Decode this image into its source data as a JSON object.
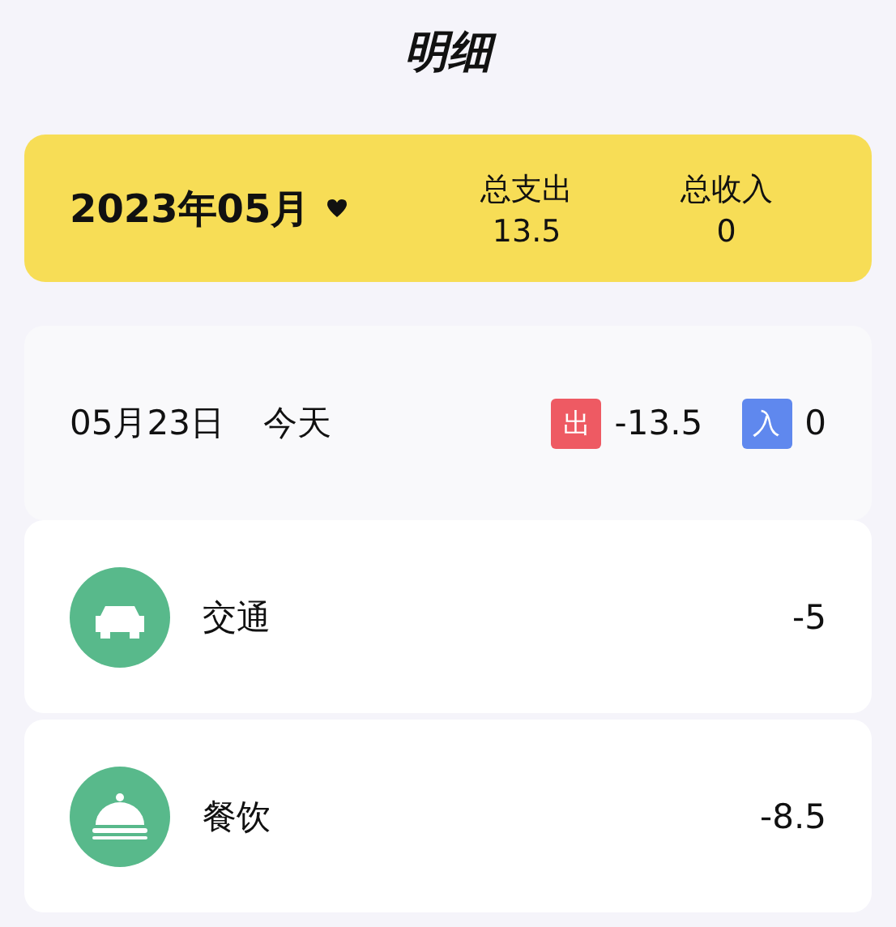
{
  "title": "明细",
  "summary": {
    "month": "2023年05月",
    "expense_label": "总支出",
    "expense": "13.5",
    "income_label": "总收入",
    "income": "0"
  },
  "day": {
    "date": "05月23日",
    "weekday": "今天",
    "out_badge": "出",
    "out": "-13.5",
    "in_badge": "入",
    "in": "0"
  },
  "entries": [
    {
      "kind": "car",
      "name": "交通",
      "amount": "-5"
    },
    {
      "kind": "food",
      "name": "餐饮",
      "amount": "-8.5"
    }
  ]
}
